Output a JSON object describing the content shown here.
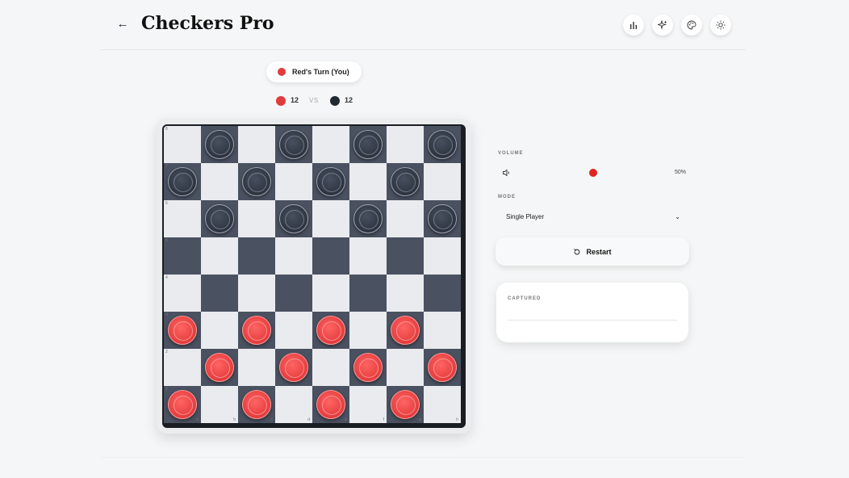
{
  "header": {
    "title": "Checkers Pro",
    "back_icon": "arrow-left-icon",
    "toolbar_icons": [
      "stats-icon",
      "sparkles-icon",
      "palette-icon",
      "sun-icon"
    ]
  },
  "status": {
    "turn_label": "Red's Turn (You)",
    "red_count": "12",
    "vs_label": "VS",
    "black_count": "12"
  },
  "board": {
    "ranks": [
      "8",
      "7",
      "6",
      "5",
      "4",
      "3",
      "2",
      "1"
    ],
    "files": [
      "a",
      "b",
      "c",
      "d",
      "e",
      "f",
      "g",
      "h"
    ],
    "rows": [
      "_b_b_b_b",
      "b_b_b_b_",
      "_b_b_b_b",
      "________",
      "________",
      "r_r_r_r_",
      "_r_r_r_r",
      "r_r_r_r_"
    ]
  },
  "panel": {
    "volume_label": "VOLUME",
    "volume_value": 0.5,
    "volume_text": "50%",
    "mode_label": "MODE",
    "mode_value": "Single Player",
    "restart_label": "Restart",
    "captured_label": "CAPTURED"
  },
  "colors": {
    "red": "#e23b3b",
    "black": "#222830",
    "dark_square": "#4a5160",
    "light_square": "#e9ebef",
    "accent": "#e02424"
  }
}
